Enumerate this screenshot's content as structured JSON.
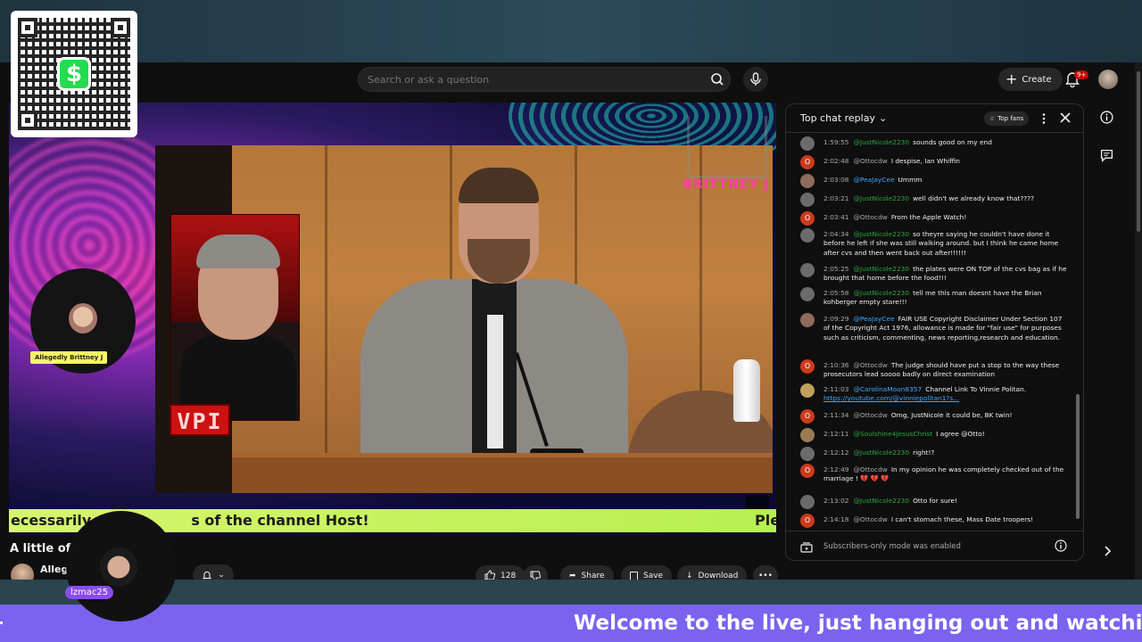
{
  "header": {
    "search_placeholder": "Search or ask a question",
    "create_label": "Create",
    "notifications_badge": "9+"
  },
  "video": {
    "brand_name": "BRITTNEY J",
    "cam_label": "Allegedly Brittney J",
    "vpi_logo": "VPI",
    "ticker_text": "ecessarily",
    "ticker_text_2": "s of the channel Host!",
    "ticker_right": "Ple"
  },
  "below": {
    "title": "A little of F",
    "owner_name": "Alleg",
    "cam2_label": "lzmac25",
    "like_count": "128",
    "share_label": "Share",
    "save_label": "Save",
    "download_label": "Download"
  },
  "chat": {
    "title": "Top chat replay",
    "top_fans_label": "Top fans",
    "footer_text": "Subscribers-only mode was enabled",
    "messages": [
      {
        "time": "1:59:55",
        "author": "@JustNicole2230",
        "text": "sounds good on my end",
        "color": "#2ba640"
      },
      {
        "time": "2:02:48",
        "author": "@Ottocdw",
        "text": "I despise, Ian Whiffin",
        "color": "#aaaaaa"
      },
      {
        "time": "2:03:08",
        "author": "@PeaJayCee",
        "text": "Ummm",
        "color": "#3ea6ff"
      },
      {
        "time": "2:03:21",
        "author": "@JustNicole2230",
        "text": "well didn't we already know that????",
        "color": "#2ba640"
      },
      {
        "time": "2:03:41",
        "author": "@Ottocdw",
        "text": "From the Apple Watch!",
        "color": "#aaaaaa"
      },
      {
        "time": "2:04:34",
        "author": "@JustNicole2230",
        "text": "so theyre saying he couldn't have done it before he left if she was still walking around. but I think he came home after cvs and then went back out after!!!!!!",
        "color": "#2ba640"
      },
      {
        "time": "2:05:25",
        "author": "@JustNicole2230",
        "text": "the plates were ON TOP of the cvs bag as if he brought that home before the food!!!",
        "color": "#2ba640"
      },
      {
        "time": "2:05:58",
        "author": "@JustNicole2230",
        "text": "tell me this man doesnt have the Brian kohberger empty stare!!!",
        "color": "#2ba640"
      },
      {
        "time": "2:09:29",
        "author": "@PeaJayCee",
        "text": "FAIR USE Copyright Disclaimer Under Section 107 of the Copyright Act 1976, allowance is made for \"fair use\" for purposes such as criticism, commenting, news reporting,research and education.",
        "color": "#3ea6ff"
      },
      {
        "time": "2:10:36",
        "author": "@Ottocdw",
        "text": "The judge should have put a stop to the way these prosecutors lead soooo badly on direct examination",
        "color": "#aaaaaa"
      },
      {
        "time": "2:11:03",
        "author": "@CarolinaMoon8357",
        "text": "Channel Link To Vinnie Politan.",
        "link": "https://youtube.com/@vinniepolitan1?s...",
        "color": "#3ea6ff"
      },
      {
        "time": "2:11:34",
        "author": "@Ottocdw",
        "text": "Omg, JustNicole it could be, BK twin!",
        "color": "#aaaaaa"
      },
      {
        "time": "2:12:11",
        "author": "@Soulshine4JesusChrist",
        "text": "I agree @Otto!",
        "color": "#2ba640"
      },
      {
        "time": "2:12:12",
        "author": "@JustNicole2230",
        "text": "right!?",
        "color": "#2ba640"
      },
      {
        "time": "2:12:49",
        "author": "@Ottocdw",
        "text": "In my opinion he was completely checked out of the marriage ! 💔 💔 💔",
        "color": "#aaaaaa"
      },
      {
        "time": "2:13:02",
        "author": "@JustNicole2230",
        "text": "Otto for sure!",
        "color": "#2ba640"
      },
      {
        "time": "2:14:18",
        "author": "@Ottocdw",
        "text": "I can't stomach these, Mass Date troopers!",
        "color": "#aaaaaa"
      }
    ]
  },
  "banner": {
    "text": "Welcome to the live, just hanging out and watching a li"
  }
}
